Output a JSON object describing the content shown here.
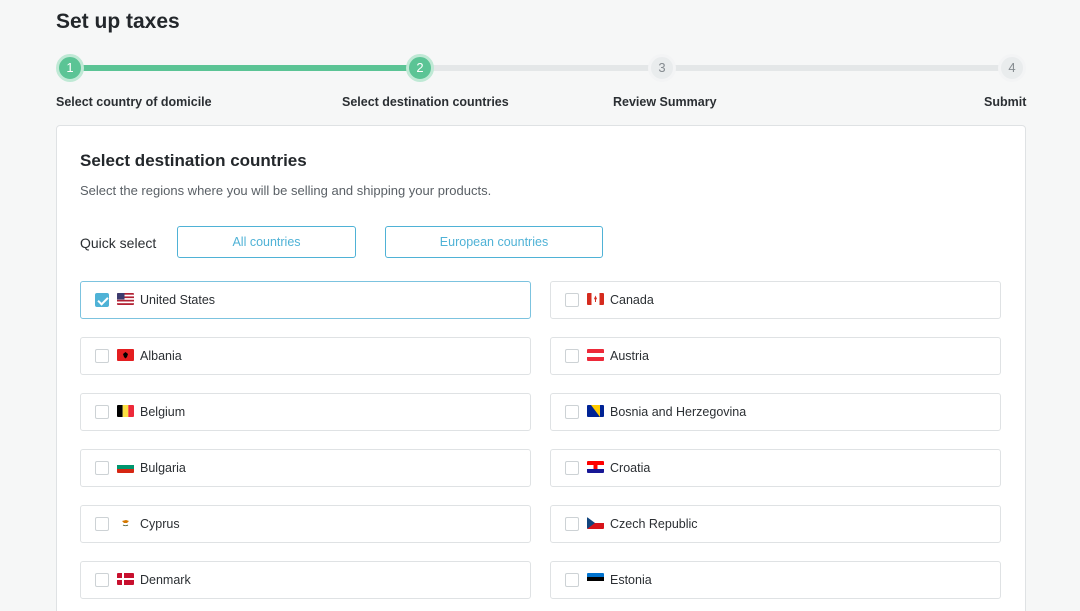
{
  "page": {
    "title": "Set up taxes"
  },
  "stepper": {
    "steps": [
      {
        "number": "1",
        "label": "Select country of domicile",
        "state": "done"
      },
      {
        "number": "2",
        "label": "Select destination countries",
        "state": "current"
      },
      {
        "number": "3",
        "label": "Review Summary",
        "state": "todo"
      },
      {
        "number": "4",
        "label": "Submit",
        "state": "todo"
      }
    ]
  },
  "card": {
    "title": "Select destination countries",
    "subtitle": "Select the regions where you will be selling and shipping your products.",
    "quick_select": {
      "label": "Quick select",
      "all_label": "All countries",
      "european_label": "European countries"
    }
  },
  "countries": [
    {
      "name": "United States",
      "flag": "us-flag",
      "checked": true
    },
    {
      "name": "Canada",
      "flag": "canada-flag",
      "checked": false
    },
    {
      "name": "Albania",
      "flag": "albania-flag",
      "checked": false
    },
    {
      "name": "Austria",
      "flag": "austria-flag",
      "checked": false
    },
    {
      "name": "Belgium",
      "flag": "belgium-flag",
      "checked": false
    },
    {
      "name": "Bosnia and Herzegovina",
      "flag": "bosnia-flag",
      "checked": false
    },
    {
      "name": "Bulgaria",
      "flag": "bulgaria-flag",
      "checked": false
    },
    {
      "name": "Croatia",
      "flag": "croatia-flag",
      "checked": false
    },
    {
      "name": "Cyprus",
      "flag": "cyprus-flag",
      "checked": false
    },
    {
      "name": "Czech Republic",
      "flag": "czech-flag",
      "checked": false
    },
    {
      "name": "Denmark",
      "flag": "denmark-flag",
      "checked": false
    },
    {
      "name": "Estonia",
      "flag": "estonia-flag",
      "checked": false
    }
  ],
  "colors": {
    "accent": "#4fb2d6",
    "progress": "#5bc495"
  }
}
